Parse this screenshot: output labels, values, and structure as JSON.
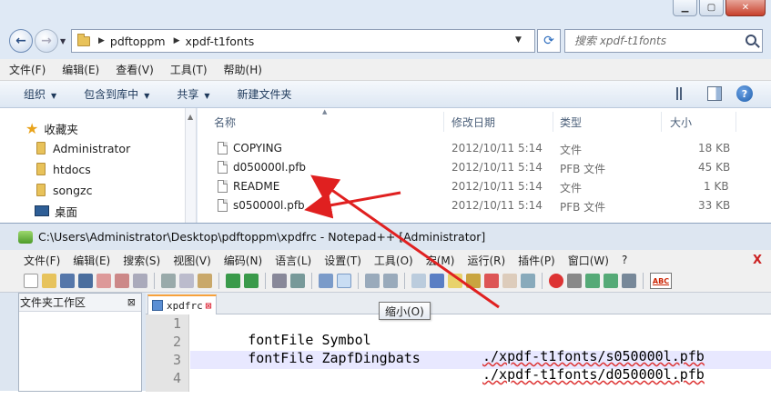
{
  "explorer": {
    "breadcrumb": [
      "pdftoppm",
      "xpdf-t1fonts"
    ],
    "search_placeholder": "搜索 xpdf-t1fonts",
    "menu": [
      "文件(F)",
      "编辑(E)",
      "查看(V)",
      "工具(T)",
      "帮助(H)"
    ],
    "commands": [
      "组织",
      "包含到库中",
      "共享",
      "新建文件夹"
    ],
    "nav": {
      "favorites": "收藏夹",
      "items": [
        "Administrator",
        "htdocs",
        "songzc",
        "桌面"
      ]
    },
    "columns": [
      "名称",
      "修改日期",
      "类型",
      "大小"
    ],
    "files": [
      {
        "name": "COPYING",
        "date": "2012/10/11 5:14",
        "type": "文件",
        "size": "18 KB"
      },
      {
        "name": "d050000l.pfb",
        "date": "2012/10/11 5:14",
        "type": "PFB 文件",
        "size": "45 KB"
      },
      {
        "name": "README",
        "date": "2012/10/11 5:14",
        "type": "文件",
        "size": "1 KB"
      },
      {
        "name": "s050000l.pfb",
        "date": "2012/10/11 5:14",
        "type": "PFB 文件",
        "size": "33 KB"
      }
    ]
  },
  "notepad": {
    "title": "C:\\Users\\Administrator\\Desktop\\pdftoppm\\xpdfrc - Notepad++ [Administrator]",
    "menu": [
      "文件(F)",
      "编辑(E)",
      "搜索(S)",
      "视图(V)",
      "编码(N)",
      "语言(L)",
      "设置(T)",
      "工具(O)",
      "宏(M)",
      "运行(R)",
      "插件(P)",
      "窗口(W)",
      "?"
    ],
    "menu_close": "X",
    "workspace_title": "文件夹工作区",
    "tab_label": "xpdfrc",
    "tooltip": "缩小(O)",
    "lines": [
      {
        "num": "1",
        "text": "fontFile Symbol",
        "path": "./xpdf-t1fonts/s050000l.pfb"
      },
      {
        "num": "2",
        "text": "fontFile ZapfDingbats",
        "path": "./xpdf-t1fonts/d050000l.pfb"
      },
      {
        "num": "3",
        "text": "",
        "path": ""
      },
      {
        "num": "4",
        "text": "",
        "path": ""
      }
    ]
  },
  "colors": {
    "explorer_bg": "#dfe9f5",
    "arrow_red": "#e02020",
    "current_line": "#e8e8ff"
  }
}
